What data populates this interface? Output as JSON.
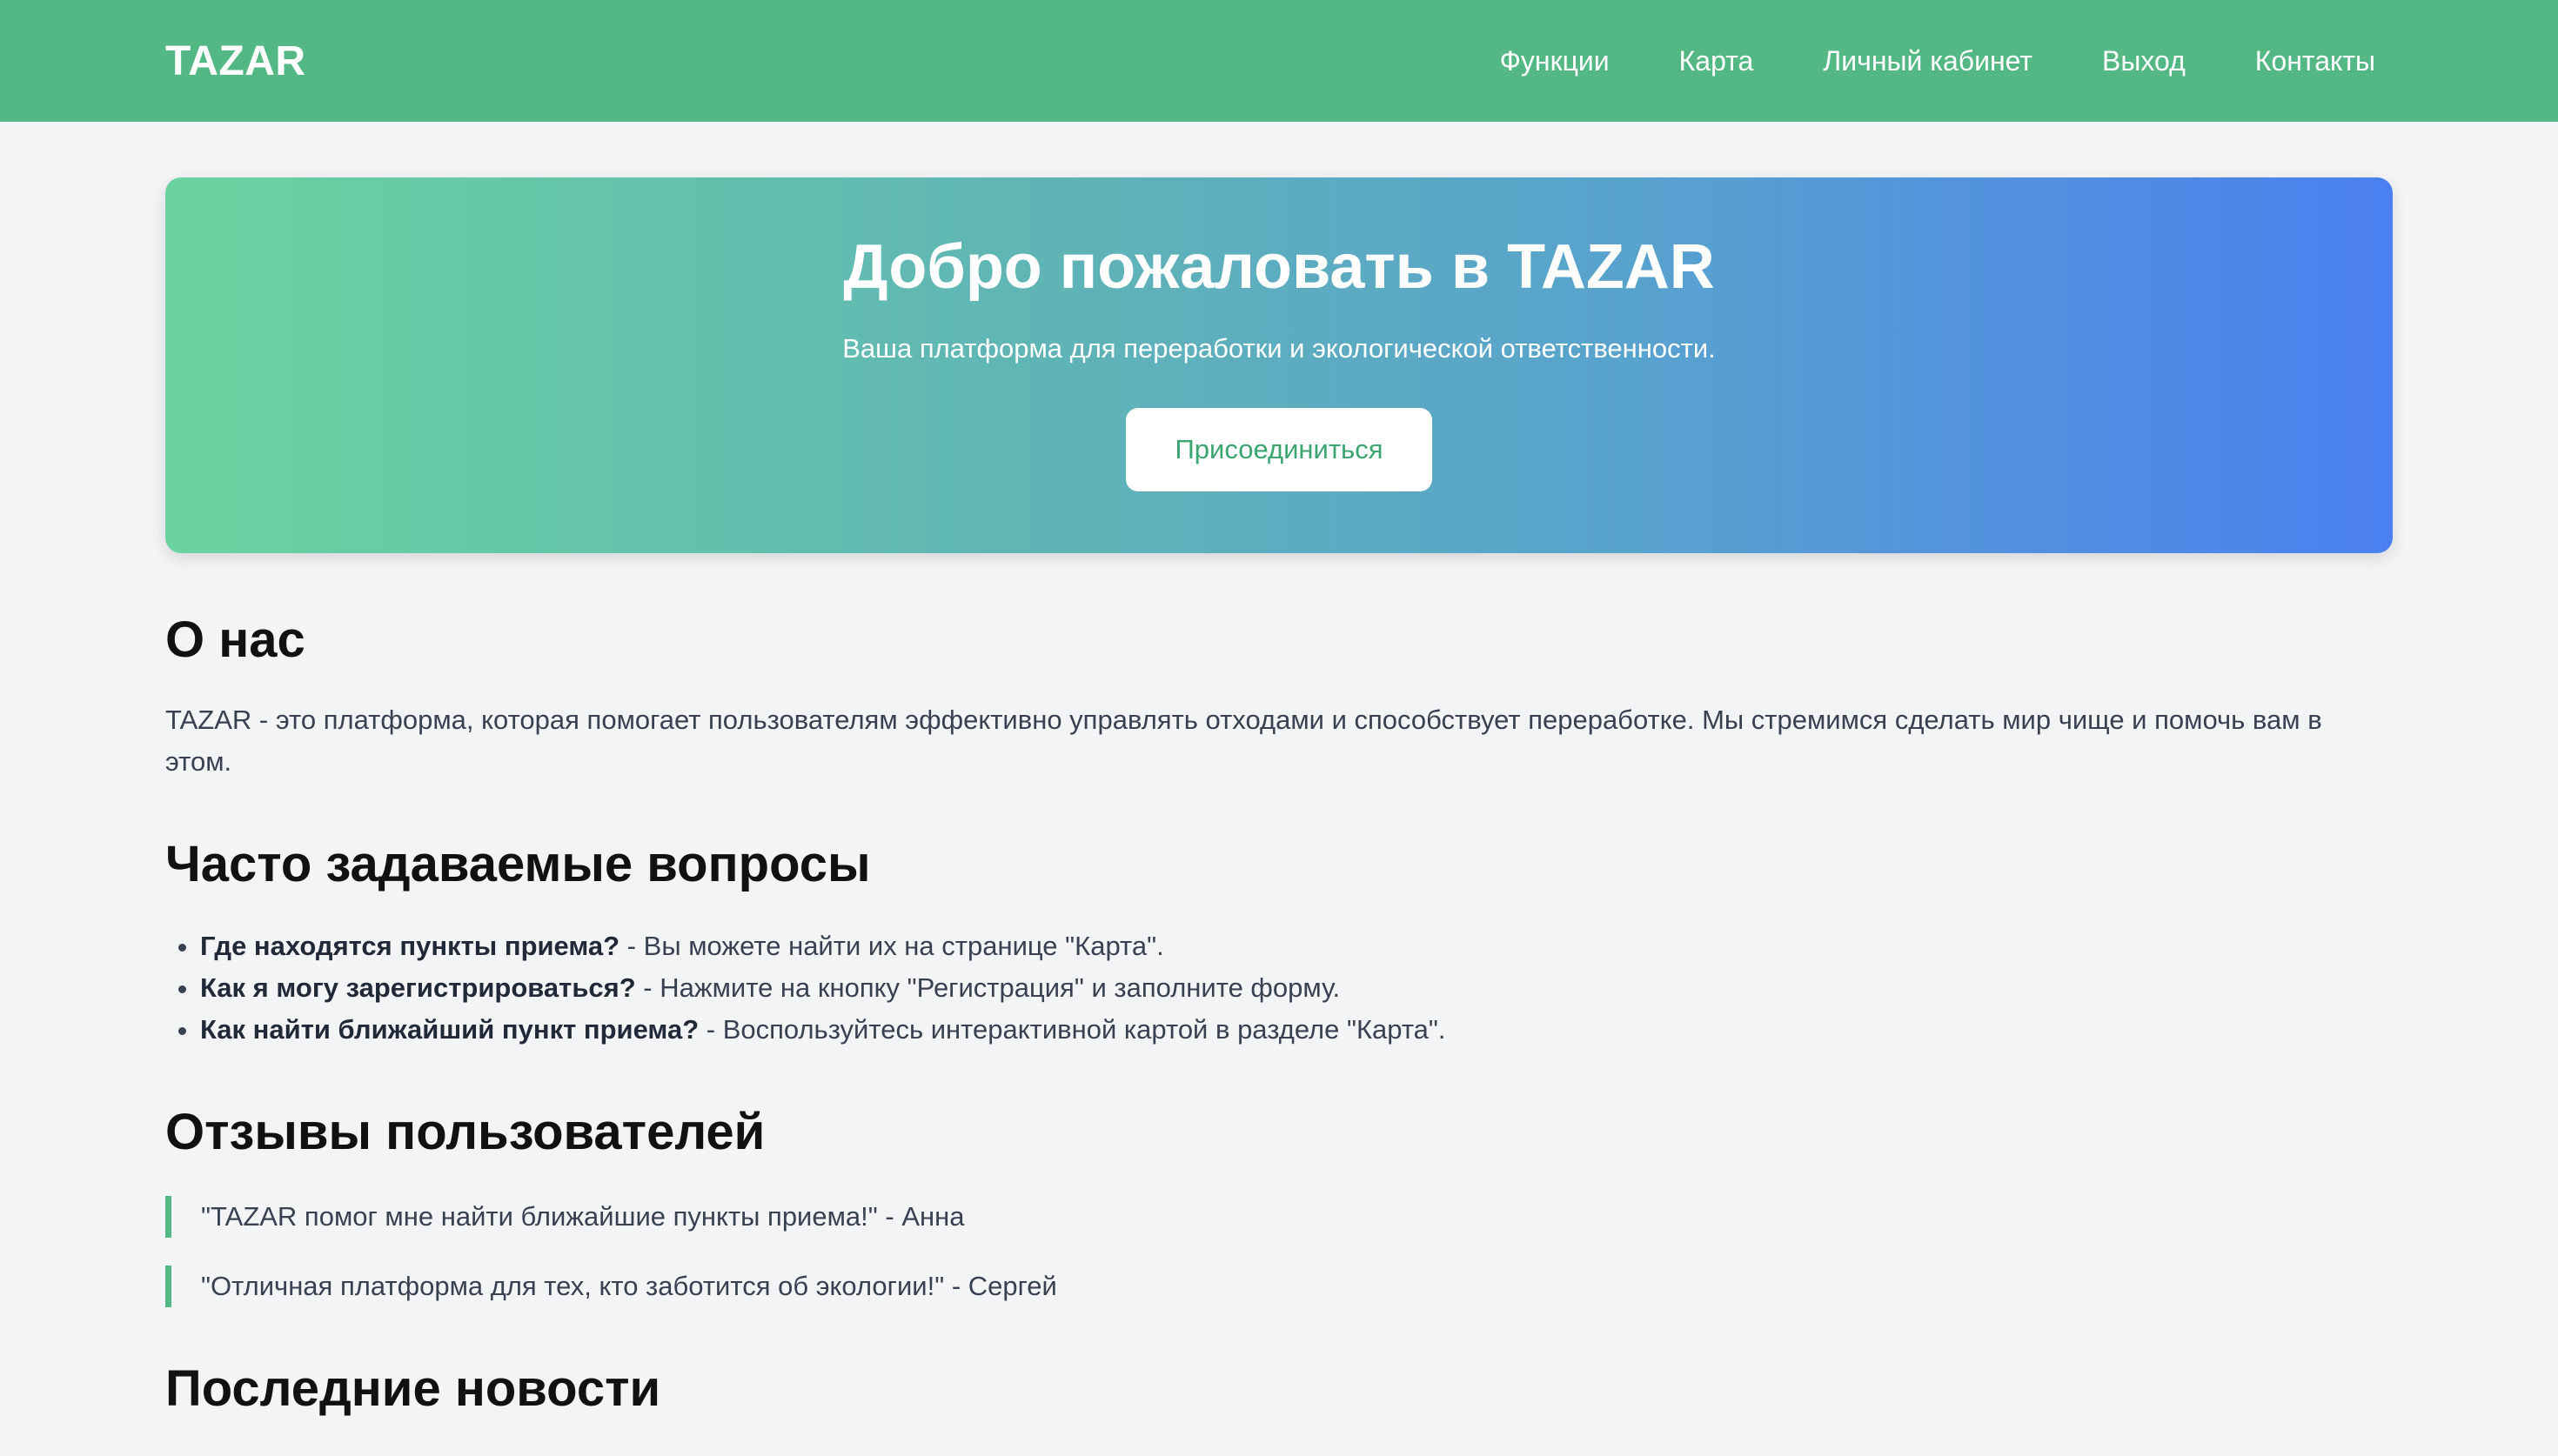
{
  "navbar": {
    "brand": "TAZAR",
    "links": [
      "Функции",
      "Карта",
      "Личный кабинет",
      "Выход",
      "Контакты"
    ]
  },
  "hero": {
    "title": "Добро пожаловать в TAZAR",
    "subtitle": "Ваша платформа для переработки и экологической ответственности.",
    "button": "Присоединиться"
  },
  "about": {
    "title": "О нас",
    "text": "TAZAR - это платформа, которая помогает пользователям эффективно управлять отходами и способствует переработке. Мы стремимся сделать мир чище и помочь вам в этом."
  },
  "faq": {
    "title": "Часто задаваемые вопросы",
    "items": [
      {
        "q": "Где находятся пункты приема?",
        "a": " - Вы можете найти их на странице \"Карта\"."
      },
      {
        "q": "Как я могу зарегистрироваться?",
        "a": " - Нажмите на кнопку \"Регистрация\" и заполните форму."
      },
      {
        "q": "Как найти ближайший пункт приема?",
        "a": " - Воспользуйтесь интерактивной картой в разделе \"Карта\"."
      }
    ]
  },
  "reviews": {
    "title": "Отзывы пользователей",
    "items": [
      "\"TAZAR помог мне найти ближайшие пункты приема!\" - Анна",
      "\"Отличная платформа для тех, кто заботится об экологии!\" - Сергей"
    ]
  },
  "news": {
    "title": "Последние новости"
  },
  "colors": {
    "brand_green": "#54b885",
    "gradient_start": "#6bd39f",
    "gradient_end": "#4b7ff0",
    "button_text": "#3aa56f",
    "background": "#f3f4f6"
  }
}
